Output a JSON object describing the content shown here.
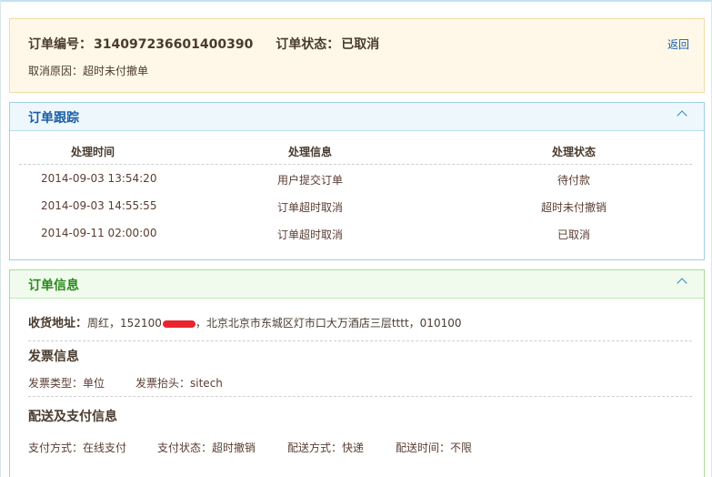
{
  "summary": {
    "order_no_label": "订单编号：",
    "order_no": "314097236601400390",
    "status_label": "订单状态：",
    "status": "已取消",
    "back_link": "返回",
    "cancel_reason_label": "取消原因：",
    "cancel_reason": "超时未付撤单"
  },
  "tracking": {
    "title": "订单跟踪",
    "columns": [
      "处理时间",
      "处理信息",
      "处理状态"
    ],
    "rows": [
      {
        "time": "2014-09-03 13:54:20",
        "info": "用户提交订单",
        "status": "待付款"
      },
      {
        "time": "2014-09-03 14:55:55",
        "info": "订单超时取消",
        "status": "超时未付撤销"
      },
      {
        "time": "2014-09-11 02:00:00",
        "info": "订单超时取消",
        "status": "已取消"
      }
    ]
  },
  "order_info": {
    "title": "订单信息",
    "address_label": "收货地址：",
    "recipient": "周红，",
    "phone_prefix": "152100",
    "address_rest": "，北京北京市东城区灯市口大万酒店三层tttt，",
    "postcode": "010100",
    "invoice_title": "发票信息",
    "invoice_type_label": "发票类型：",
    "invoice_type": "单位",
    "invoice_header_label": "发票抬头：",
    "invoice_header": "sitech",
    "delivery_title": "配送及支付信息",
    "pay_method_label": "支付方式：",
    "pay_method": "在线支付",
    "pay_status_label": "支付状态：",
    "pay_status": "超时撤销",
    "ship_method_label": "配送方式：",
    "ship_method": "快递",
    "ship_time_label": "配送时间：",
    "ship_time": "不限"
  },
  "colors": {
    "summary_bg": "#fff8e8",
    "tracking_accent": "#1a5ea8",
    "info_accent": "#2a8a1c",
    "redaction": "#e8242f"
  },
  "icons": {
    "collapse": "chevron-up-icon"
  }
}
